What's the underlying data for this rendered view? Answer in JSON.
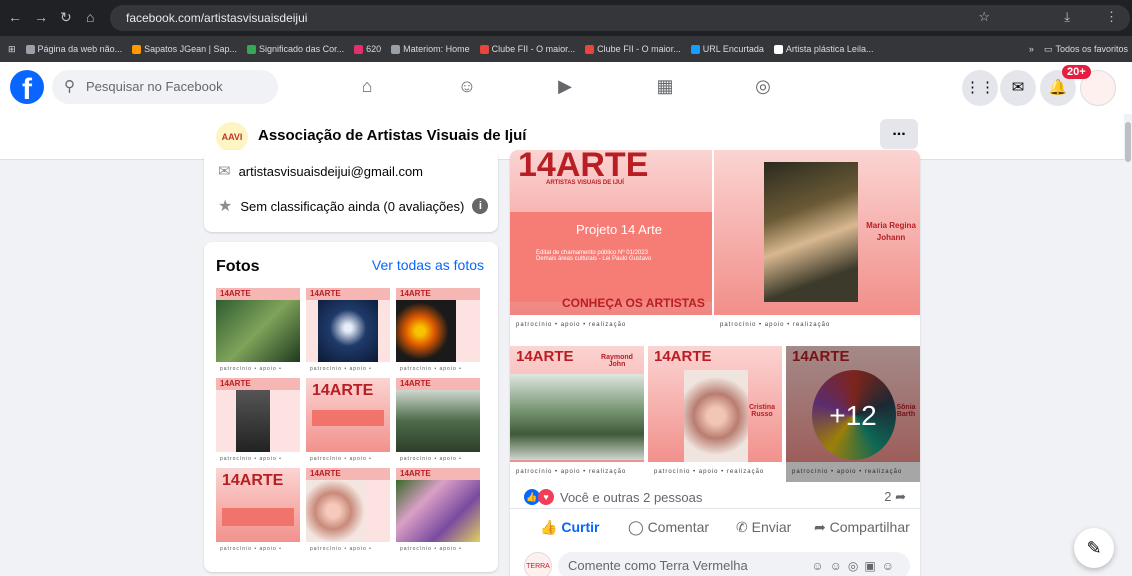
{
  "browser": {
    "url": "facebook.com/artistasvisuaisdeijui",
    "bookmarks": [
      {
        "label": "Página da web não...",
        "color": "#9aa0a6"
      },
      {
        "label": "Sapatos JGean | Sap...",
        "color": "#ff9900"
      },
      {
        "label": "Significado das Cor...",
        "color": "#34a853"
      },
      {
        "label": "620",
        "color": "#e1306c"
      },
      {
        "label": "Materiom: Home",
        "color": "#9aa0a6"
      },
      {
        "label": "Clube FII - O maior...",
        "color": "#e8453c"
      },
      {
        "label": "Clube FII - O maior...",
        "color": "#e8453c"
      },
      {
        "label": "URL Encurtada",
        "color": "#1a9cff"
      },
      {
        "label": "Artista plástica Leila...",
        "color": "#ffffff"
      }
    ],
    "more_bookmarks": "»",
    "all_bookmarks": "Todos os favoritos"
  },
  "fb": {
    "search_placeholder": "Pesquisar no Facebook",
    "notif_count": "20+",
    "brand_color": "#0866ff"
  },
  "page": {
    "logo_text": "AAVI",
    "title": "Associação de Artistas Visuais de Ijuí",
    "more": "..."
  },
  "info": {
    "email": "artistasvisuaisdeijui@gmail.com",
    "rating": "Sem classificação ainda (0 avaliações)"
  },
  "photos": {
    "title": "Fotos",
    "see_all": "Ver todas as fotos",
    "tile_label": "14ARTE",
    "tile_foot": "patrocínio • apoio • realização"
  },
  "post": {
    "main_title": "14ARTE",
    "main_subtitle": "ARTISTAS VISUAIS DE IJUÍ",
    "project_text": "Projeto 14 Arte",
    "edital_text": "Edital de chamamento público Nº 01/2023\nDemais áreas culturais - Lei Paulo Gustavo",
    "cta": "CONHEÇA OS ARTISTAS",
    "artist1": "Maria Regina Johann",
    "artist2": "Raymond John",
    "artist3": "Cristina Russo",
    "artist4": "Sônia Barth",
    "more_count": "+12",
    "reactions_text": "Você e outras 2 pessoas",
    "shares_count": "2",
    "like": "Curtir",
    "comment": "Comentar",
    "send": "Enviar",
    "share": "Compartilhar",
    "comment_placeholder": "Comente como Terra Vermelha",
    "avatar_text": "TERRA"
  }
}
